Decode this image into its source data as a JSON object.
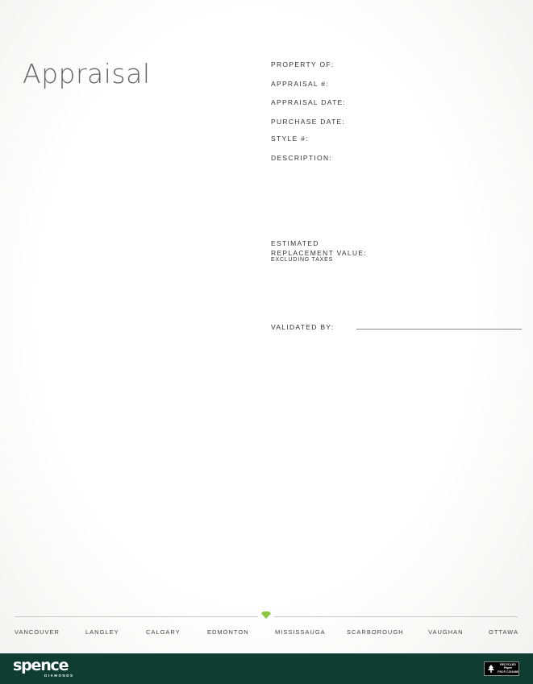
{
  "document": {
    "title": "Appraisal"
  },
  "fields": {
    "property_of": "PROPERTY OF:",
    "appraisal_no": "APPRAISAL #:",
    "appraisal_date": "APPRAISAL  DATE:",
    "purchase_date": "PURCHASE  DATE:",
    "style_no": "STYLE #:",
    "description": "DESCRIPTION:",
    "estimated": "ESTIMATED",
    "replacement_value": "REPLACEMENT VALUE:",
    "excluding_taxes": "EXCLUDING TAXES",
    "validated_by": "VALIDATED BY:"
  },
  "cities": [
    "VANCOUVER",
    "LANGLEY",
    "CALGARY",
    "EDMONTON",
    "MISSISSAUGA",
    "SCARBOROUGH",
    "VAUGHAN",
    "OTTAWA"
  ],
  "footer": {
    "logo": "spence",
    "logo_sub": "DIAMONDS",
    "fsc_line1": "RECYCLED",
    "fsc_line2": "Paper",
    "fsc_line3": "FSC® C016486",
    "fsc_mark": "FSC"
  },
  "colors": {
    "footer_bg": "#0f3d31",
    "diamond": "#8cc63f"
  }
}
